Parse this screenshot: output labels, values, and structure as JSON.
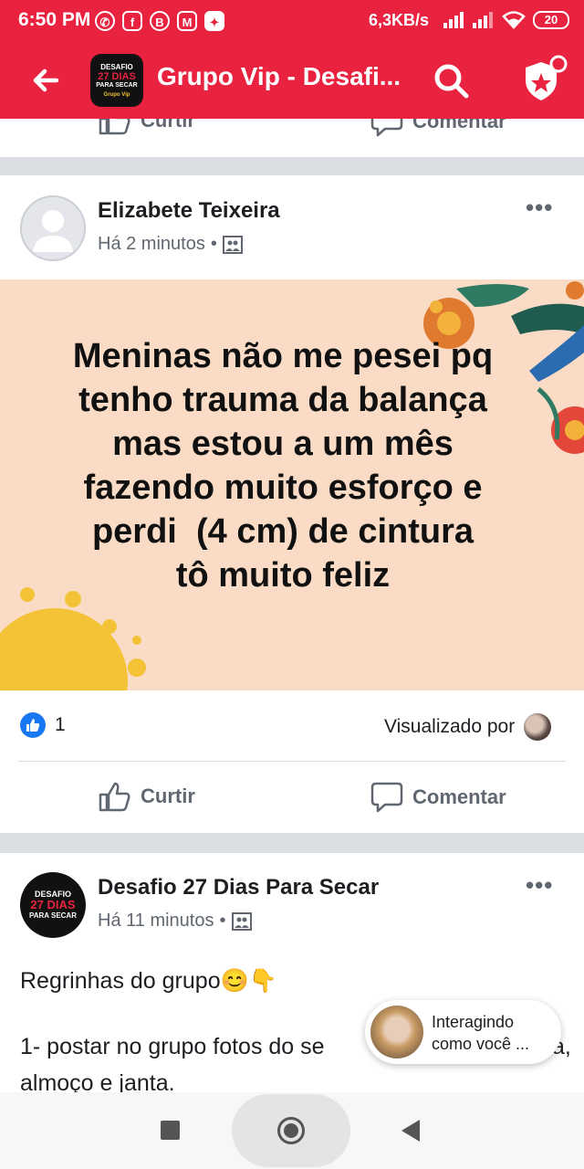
{
  "status_bar": {
    "time": "6:50 PM",
    "notification_icons": [
      "whatsapp-icon",
      "facebook-icon",
      "b-icon",
      "gmail-icon",
      "game-icon"
    ],
    "net_speed": "6,3KB/s",
    "battery": "20"
  },
  "header": {
    "title": "Grupo Vip - Desafi...",
    "logo_text": [
      "DESAFIO",
      "27 DIAS",
      "PARA SECAR",
      "Grupo Vip"
    ],
    "accent_color": "#e8223f"
  },
  "prev_post": {
    "like_label": "Curtir",
    "comment_label": "Comentar"
  },
  "post1": {
    "author": "Elizabete Teixeira",
    "time": "Há 2 minutos",
    "text_lines": [
      "Meninas não me pesei pq",
      "tenho trauma da balança",
      "mas estou a um mês",
      "fazendo muito esforço e",
      "perdi  (4 cm) de cintura",
      "tô muito feliz"
    ],
    "background_color": "#fadcc6",
    "reaction_count": "1",
    "seen_by_label": "Visualizado por",
    "like_label": "Curtir",
    "comment_label": "Comentar"
  },
  "post2": {
    "author": "Desafio 27 Dias Para Secar",
    "time": "Há 11 minutos",
    "avatar_text": [
      "DESAFIO",
      "27 DIAS",
      "PARA SECAR"
    ],
    "text_line1": "Regrinhas do grupo😊👇",
    "text_line2": "1- postar no grupo fotos do se",
    "text_line2_end": "a,",
    "text_line3": "almoço e janta."
  },
  "interacting_bubble": {
    "line1": "Interagindo",
    "line2": "como você ..."
  }
}
